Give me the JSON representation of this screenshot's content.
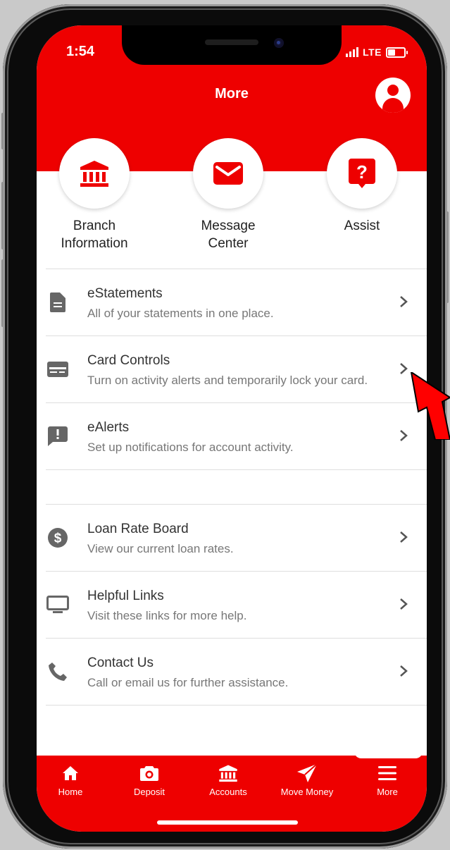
{
  "status_bar": {
    "time": "1:54",
    "network": "LTE"
  },
  "header": {
    "title": "More"
  },
  "quick_actions": [
    {
      "label_line1": "Branch",
      "label_line2": "Information",
      "icon": "bank-icon"
    },
    {
      "label_line1": "Message",
      "label_line2": "Center",
      "icon": "envelope-icon"
    },
    {
      "label_line1": "Assist",
      "label_line2": "",
      "icon": "help-icon"
    }
  ],
  "list_group_1": [
    {
      "title": "eStatements",
      "description": "All of your statements in one place.",
      "icon": "document-icon"
    },
    {
      "title": "Card Controls",
      "description": "Turn on activity alerts and temporarily lock your card.",
      "icon": "credit-card-icon"
    },
    {
      "title": "eAlerts",
      "description": "Set up notifications for account activity.",
      "icon": "alert-icon"
    }
  ],
  "list_group_2": [
    {
      "title": "Loan Rate Board",
      "description": "View our current loan rates.",
      "icon": "dollar-icon"
    },
    {
      "title": "Helpful Links",
      "description": "Visit these links for more help.",
      "icon": "monitor-icon"
    },
    {
      "title": "Contact Us",
      "description": "Call or email us for further assistance.",
      "icon": "phone-icon"
    }
  ],
  "tab_bar": [
    {
      "label": "Home",
      "icon": "home-icon"
    },
    {
      "label": "Deposit",
      "icon": "camera-icon"
    },
    {
      "label": "Accounts",
      "icon": "bank-icon"
    },
    {
      "label": "Move Money",
      "icon": "send-icon"
    },
    {
      "label": "More",
      "icon": "menu-icon"
    }
  ],
  "colors": {
    "brand": "#ee0000",
    "text": "#333333",
    "muted": "#777777",
    "icon": "#666666"
  }
}
